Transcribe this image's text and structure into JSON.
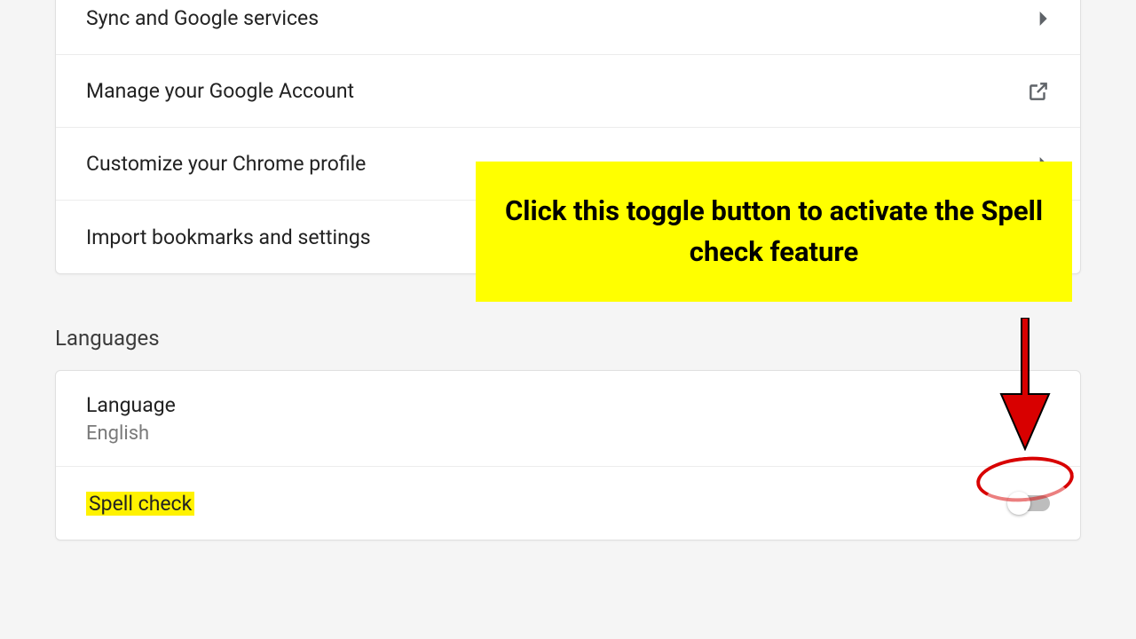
{
  "section1": {
    "rows": [
      {
        "label": "Sync and Google services",
        "icon": "chevron"
      },
      {
        "label": "Manage your Google Account",
        "icon": "external"
      },
      {
        "label": "Customize your Chrome profile",
        "icon": "chevron"
      },
      {
        "label": "Import bookmarks and settings",
        "icon": "none"
      }
    ]
  },
  "languages": {
    "header": "Languages",
    "language_row": {
      "label": "Language",
      "value": "English"
    },
    "spellcheck_row": {
      "label": "Spell check",
      "toggle": false
    }
  },
  "annotation": {
    "callout": "Click this toggle button to activate the Spell check feature"
  }
}
